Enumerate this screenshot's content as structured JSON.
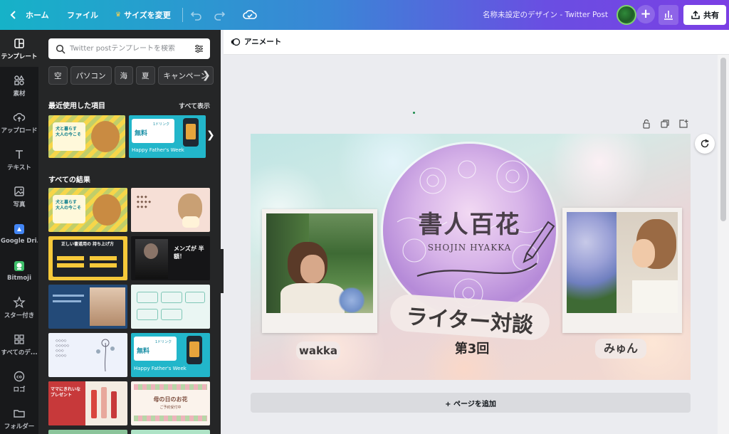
{
  "topbar": {
    "home_label": "ホーム",
    "file_label": "ファイル",
    "resize_label": "サイズを変更",
    "doc_title": "名称未設定のデザイン - Twitter Post",
    "share_label": "共有"
  },
  "rail": {
    "items": [
      {
        "label": "テンプレート",
        "icon": "template-icon"
      },
      {
        "label": "素材",
        "icon": "elements-icon"
      },
      {
        "label": "アップロード",
        "icon": "upload-icon"
      },
      {
        "label": "テキスト",
        "icon": "text-icon"
      },
      {
        "label": "写真",
        "icon": "photo-icon"
      },
      {
        "label": "Google Dri...",
        "icon": "google-drive-icon"
      },
      {
        "label": "Bitmoji",
        "icon": "bitmoji-icon"
      },
      {
        "label": "スター付き",
        "icon": "star-icon"
      },
      {
        "label": "すべてのデ...",
        "icon": "grid-icon"
      },
      {
        "label": "ロゴ",
        "icon": "logo-icon"
      },
      {
        "label": "フォルダー",
        "icon": "folder-icon"
      }
    ]
  },
  "panel": {
    "search_placeholder": "Twitter postテンプレートを検索",
    "chips": [
      "空",
      "パソコン",
      "海",
      "夏",
      "キャンペーン"
    ],
    "recent_title": "最近使用した項目",
    "see_all": "すべて表示",
    "results_title": "すべての結果"
  },
  "thumbs": {
    "dog_caption_1": "犬と暮らす",
    "dog_caption_2": "大人の今こそ",
    "fathers_free": "無料",
    "fathers_day": "Happy Father's Week",
    "fathers_drink": "1ドリンク",
    "black_text": "メンズが 半額！",
    "yellow_title": "正しい書道用の 持ち上げ方",
    "mother_title": "母の日のお花",
    "mother_sub": "ご予約受付中",
    "mother_red": "ママにきれいな プレゼント"
  },
  "editor": {
    "animate_label": "アニメート",
    "add_page_label": "+ ページを追加"
  },
  "design": {
    "title_jp": "書人百花",
    "title_en": "SHOJIN HYAKKA",
    "banner": "ライター対談",
    "episode": "第3回",
    "name_left": "wakka",
    "name_right": "みゅん"
  },
  "colors": {
    "accent": "#7b3fe4",
    "topbar_start": "#16b2c8",
    "panel_bg": "#252627",
    "rail_bg": "#18191b"
  }
}
